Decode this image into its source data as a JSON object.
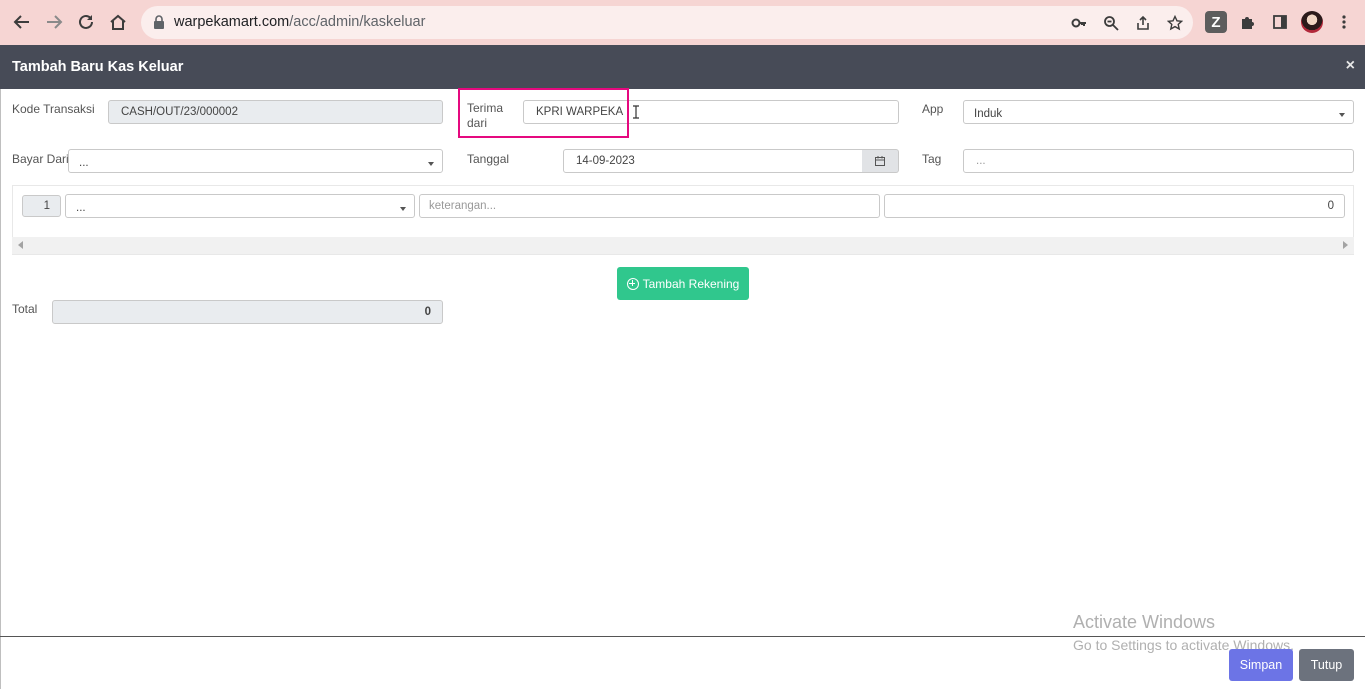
{
  "browser": {
    "url_host": "warpekamart.com",
    "url_path": "/acc/admin/kaskeluar",
    "ext_badge": "Z"
  },
  "modal": {
    "title": "Tambah Baru Kas Keluar",
    "close_symbol": "×"
  },
  "form": {
    "kode_label": "Kode Transaksi",
    "kode_value": "CASH/OUT/23/000002",
    "terima_label_1": "Terima",
    "terima_label_2": "dari",
    "terima_value": "KPRI WARPEKA",
    "app_label": "App",
    "app_value": "Induk",
    "bayar_label": "Bayar Dari",
    "bayar_value": "...",
    "tanggal_label": "Tanggal",
    "tanggal_value": "14-09-2023",
    "tag_label": "Tag",
    "tag_placeholder": "..."
  },
  "detail": {
    "row_number": "1",
    "account_value": "...",
    "keterangan_placeholder": "keterangan...",
    "amount": "0"
  },
  "add_account_label": "Tambah Rekening",
  "total": {
    "label": "Total",
    "value": "0"
  },
  "watermark": {
    "line1": "Activate Windows",
    "line2": "Go to Settings to activate Windows."
  },
  "footer": {
    "save_label": "Simpan",
    "close_label": "Tutup"
  },
  "colors": {
    "header_bg": "#474b57",
    "add_button": "#30c78d",
    "save_button": "#6c74e6",
    "close_button": "#6c727d",
    "highlight": "#e5097f"
  }
}
